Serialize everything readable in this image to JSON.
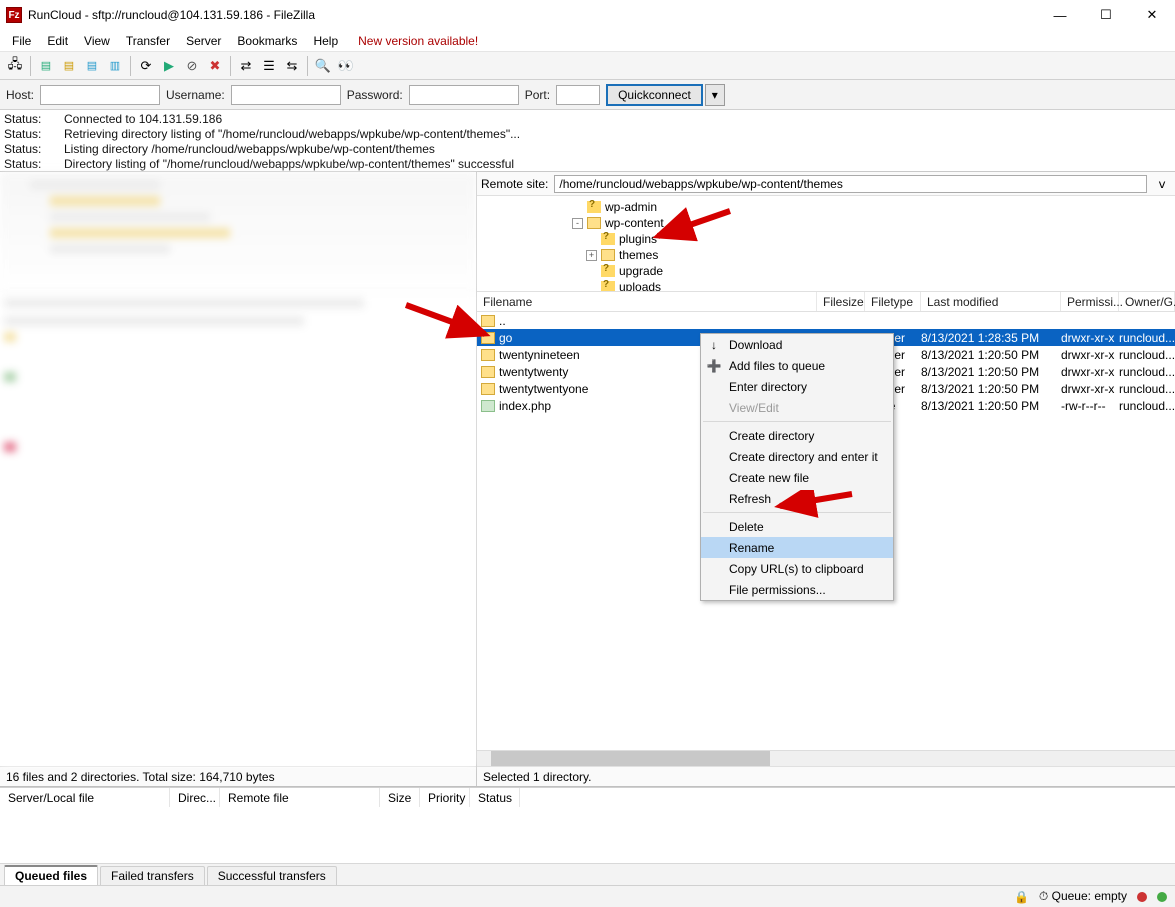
{
  "window": {
    "title": "RunCloud - sftp://runcloud@104.131.59.186 - FileZilla"
  },
  "menu": {
    "file": "File",
    "edit": "Edit",
    "view": "View",
    "transfer": "Transfer",
    "server": "Server",
    "bookmarks": "Bookmarks",
    "help": "Help",
    "new_version": "New version available!"
  },
  "quickconnect": {
    "host_lbl": "Host:",
    "user_lbl": "Username:",
    "pass_lbl": "Password:",
    "port_lbl": "Port:",
    "btn": "Quickconnect"
  },
  "log": [
    {
      "s": "Status:",
      "m": "Connected to 104.131.59.186"
    },
    {
      "s": "Status:",
      "m": "Retrieving directory listing of \"/home/runcloud/webapps/wpkube/wp-content/themes\"..."
    },
    {
      "s": "Status:",
      "m": "Listing directory /home/runcloud/webapps/wpkube/wp-content/themes"
    },
    {
      "s": "Status:",
      "m": "Directory listing of \"/home/runcloud/webapps/wpkube/wp-content/themes\" successful"
    }
  ],
  "remote": {
    "site_lbl": "Remote site:",
    "path": "/home/runcloud/webapps/wpkube/wp-content/themes",
    "tree": [
      {
        "name": "wp-admin",
        "icon": "q",
        "depth": 0,
        "exp": ""
      },
      {
        "name": "wp-content",
        "icon": "folder",
        "depth": 0,
        "exp": "-"
      },
      {
        "name": "plugins",
        "icon": "q",
        "depth": 1,
        "exp": ""
      },
      {
        "name": "themes",
        "icon": "folder",
        "depth": 1,
        "exp": "+"
      },
      {
        "name": "upgrade",
        "icon": "q",
        "depth": 1,
        "exp": ""
      },
      {
        "name": "uploads",
        "icon": "q",
        "depth": 1,
        "exp": ""
      }
    ],
    "cols": {
      "name": "Filename",
      "size": "Filesize",
      "type": "Filetype",
      "mod": "Last modified",
      "perm": "Permissi...",
      "own": "Owner/G..."
    },
    "files": [
      {
        "name": "..",
        "type": "",
        "size": "",
        "mod": "",
        "perm": "",
        "own": "",
        "icon": "folder"
      },
      {
        "name": "go",
        "type": "e folder",
        "size": "",
        "mod": "8/13/2021 1:28:35 PM",
        "perm": "drwxr-xr-x",
        "own": "runcloud...",
        "icon": "folder",
        "selected": true
      },
      {
        "name": "twentynineteen",
        "type": "e folder",
        "size": "",
        "mod": "8/13/2021 1:20:50 PM",
        "perm": "drwxr-xr-x",
        "own": "runcloud...",
        "icon": "folder"
      },
      {
        "name": "twentytwenty",
        "type": "e folder",
        "size": "",
        "mod": "8/13/2021 1:20:50 PM",
        "perm": "drwxr-xr-x",
        "own": "runcloud...",
        "icon": "folder"
      },
      {
        "name": "twentytwentyone",
        "type": "e folder",
        "size": "",
        "mod": "8/13/2021 1:20:50 PM",
        "perm": "drwxr-xr-x",
        "own": "runcloud...",
        "icon": "folder"
      },
      {
        "name": "index.php",
        "type": "P File",
        "size": "",
        "mod": "8/13/2021 1:20:50 PM",
        "perm": "-rw-r--r--",
        "own": "runcloud...",
        "icon": "php"
      }
    ]
  },
  "context_menu": [
    {
      "label": "Download",
      "icon": "↓"
    },
    {
      "label": "Add files to queue",
      "icon": "➕"
    },
    {
      "label": "Enter directory"
    },
    {
      "label": "View/Edit",
      "disabled": true
    },
    {
      "sep": true
    },
    {
      "label": "Create directory"
    },
    {
      "label": "Create directory and enter it"
    },
    {
      "label": "Create new file"
    },
    {
      "label": "Refresh"
    },
    {
      "sep": true
    },
    {
      "label": "Delete"
    },
    {
      "label": "Rename",
      "hl": true
    },
    {
      "label": "Copy URL(s) to clipboard"
    },
    {
      "label": "File permissions..."
    }
  ],
  "left_status": "16 files and 2 directories. Total size: 164,710 bytes",
  "right_status": "Selected 1 directory.",
  "transfer_cols": {
    "a": "Server/Local file",
    "b": "Direc...",
    "c": "Remote file",
    "d": "Size",
    "e": "Priority",
    "f": "Status"
  },
  "tabs": {
    "queued": "Queued files",
    "failed": "Failed transfers",
    "success": "Successful transfers"
  },
  "statusbar": {
    "queue": "Queue: empty"
  }
}
